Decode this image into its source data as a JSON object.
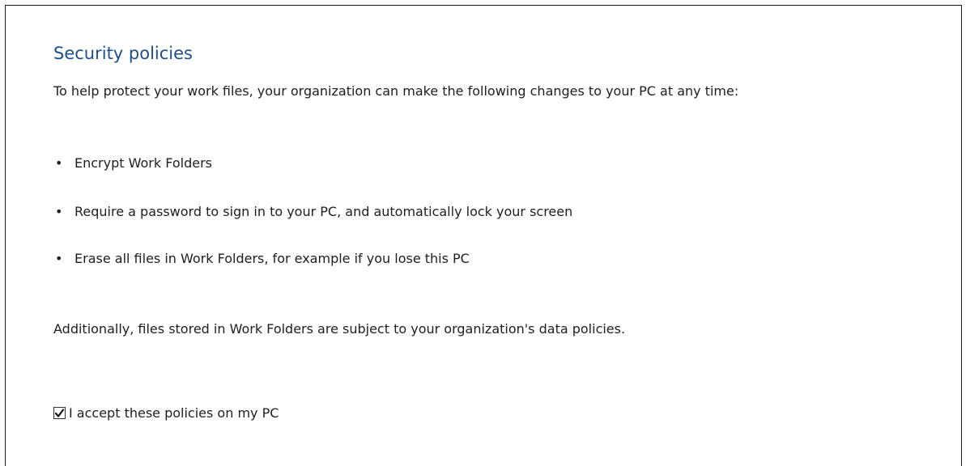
{
  "security": {
    "title": "Security policies",
    "intro": "To help protect your work files, your organization can make the following changes to your PC at any time:",
    "bullet_glyph": "•",
    "policies": [
      {
        "label": "Encrypt Work Folders"
      },
      {
        "label": "Require a password to sign in to your PC, and automatically lock your screen"
      },
      {
        "label": "Erase all files in Work Folders, for example if you lose this PC"
      }
    ],
    "note": "Additionally, files stored in Work Folders are subject to your organization's data policies.",
    "accept": {
      "label": "I accept these policies on my PC",
      "checked": true
    }
  },
  "colors": {
    "title": "#1f4e8c",
    "text": "#1e1e1e",
    "border": "#1a1a1a"
  },
  "icons": {
    "checkbox": "checkmark-icon"
  }
}
